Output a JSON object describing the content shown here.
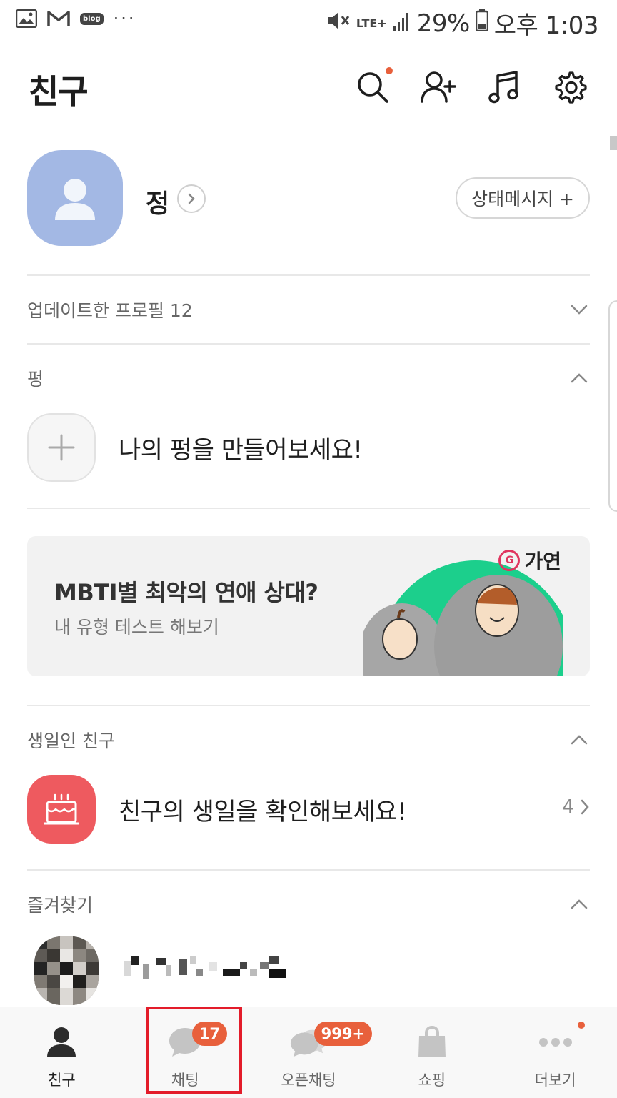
{
  "status_bar": {
    "battery": "29%",
    "network": "LTE+",
    "time": "오후 1:03",
    "blog_badge": "blog",
    "overflow": "···"
  },
  "header": {
    "title": "친구",
    "icons": [
      "search-icon",
      "add-friend-icon",
      "music-icon",
      "settings-icon"
    ]
  },
  "profile": {
    "name": "정",
    "status_button": "상태메시지 +"
  },
  "sections": {
    "updated": {
      "label": "업데이트한 프로필 12"
    },
    "pung": {
      "label": "펑",
      "item_text": "나의 펑을 만들어보세요!"
    },
    "birthday": {
      "label": "생일인 친구",
      "item_text": "친구의 생일을 확인해보세요!",
      "count": "4"
    },
    "favorites": {
      "label": "즐겨찾기"
    }
  },
  "banner": {
    "title": "MBTI별 최악의 연애 상대?",
    "subtitle": "내 유형 테스트 해보기",
    "brand": "가연",
    "brand_logo_letter": "G"
  },
  "bottom_nav": {
    "items": [
      {
        "label": "친구",
        "active": true
      },
      {
        "label": "채팅",
        "badge": "17"
      },
      {
        "label": "오픈채팅",
        "badge": "999+"
      },
      {
        "label": "쇼핑"
      },
      {
        "label": "더보기"
      }
    ]
  },
  "colors": {
    "accent_badge": "#e8603c",
    "avatar_blue": "#a3b8e4",
    "birthday_red": "#ee5a5f",
    "highlight": "#e31c2a",
    "banner_green": "#1ccf8c"
  }
}
